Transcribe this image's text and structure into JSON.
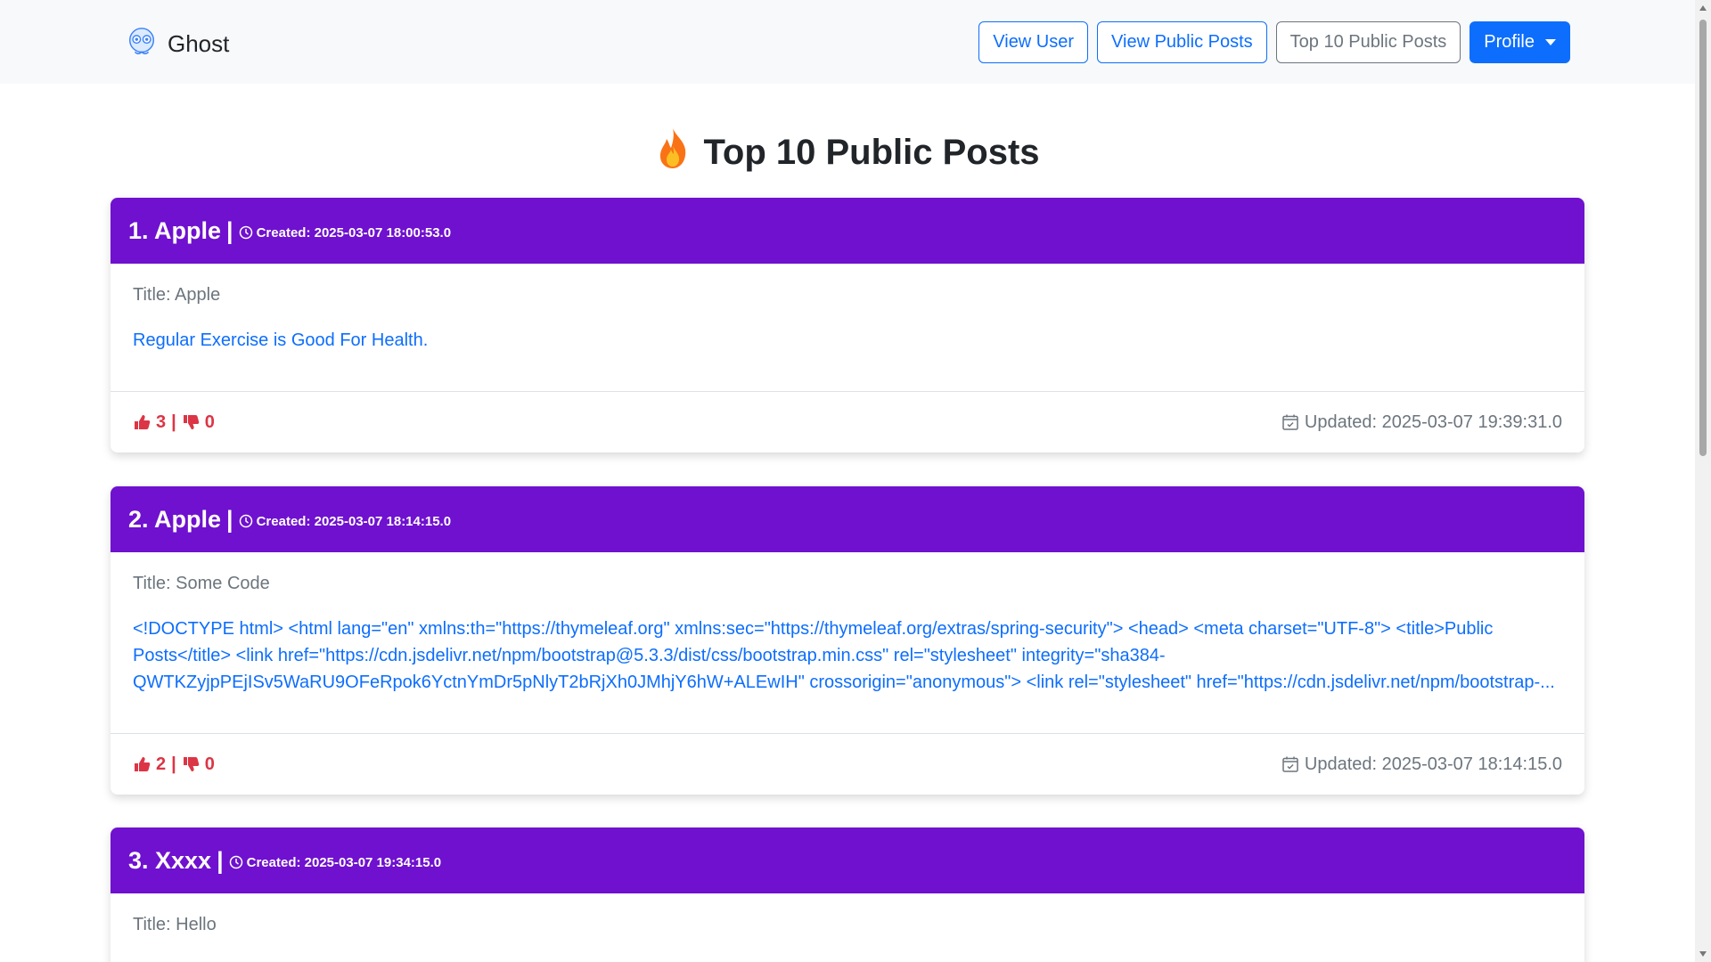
{
  "navbar": {
    "brand": "Ghost",
    "buttons": {
      "view_user": "View User",
      "view_public_posts": "View Public Posts",
      "top10": "Top 10 Public Posts",
      "profile": "Profile"
    }
  },
  "page": {
    "title": "Top 10 Public Posts",
    "title_icon": "fire-icon"
  },
  "posts": [
    {
      "rank_author": "1. Apple",
      "separator": "|",
      "created": "Created: 2025-03-07 18:00:53.0",
      "title": "Title: Apple",
      "content": "Regular Exercise is Good For Health.",
      "likes": "3",
      "vote_separator": "|",
      "dislikes": "0",
      "updated": "Updated: 2025-03-07 19:39:31.0"
    },
    {
      "rank_author": "2. Apple",
      "separator": "|",
      "created": "Created: 2025-03-07 18:14:15.0",
      "title": "Title: Some Code",
      "content": "<!DOCTYPE html> <html lang=\"en\" xmlns:th=\"https://thymeleaf.org\" xmlns:sec=\"https://thymeleaf.org/extras/spring-security\"> <head> <meta charset=\"UTF-8\"> <title>Public Posts</title> <link href=\"https://cdn.jsdelivr.net/npm/bootstrap@5.3.3/dist/css/bootstrap.min.css\" rel=\"stylesheet\" integrity=\"sha384-QWTKZyjpPEjISv5WaRU9OFeRpok6YctnYmDr5pNlyT2bRjXh0JMhjY6hW+ALEwIH\" crossorigin=\"anonymous\"> <link rel=\"stylesheet\" href=\"https://cdn.jsdelivr.net/npm/bootstrap-...",
      "likes": "2",
      "vote_separator": "|",
      "dislikes": "0",
      "updated": "Updated: 2025-03-07 18:14:15.0"
    },
    {
      "rank_author": "3. Xxxx",
      "separator": "|",
      "created": "Created: 2025-03-07 19:34:15.0",
      "title": "Title: Hello"
    }
  ],
  "colors": {
    "card_header": "#6f11cf",
    "primary": "#0d6efd",
    "danger": "#dc3545",
    "muted": "#6c757d"
  }
}
